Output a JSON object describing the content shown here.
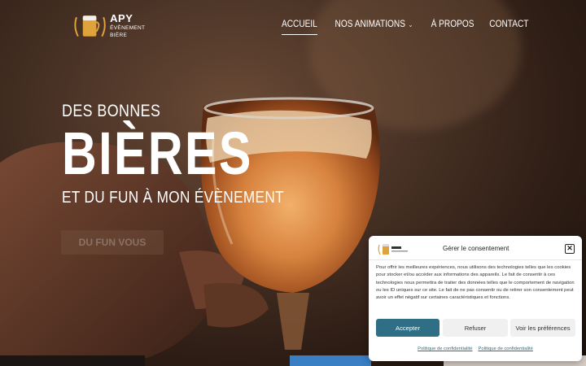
{
  "logo": {
    "title": "APY",
    "subtitle": "ÉVÈNEMENT BIÈRE"
  },
  "nav": [
    {
      "label": "ACCUEIL",
      "active": true
    },
    {
      "label": "NOS ANIMATIONS",
      "has_dropdown": true
    },
    {
      "label": "À PROPOS"
    },
    {
      "label": "CONTACT"
    }
  ],
  "hero": {
    "line1": "DES BONNES",
    "line2": "BIÈRES",
    "line3": "ET DU FUN À MON ÉVÈNEMENT",
    "cta": "DU FUN VOUS"
  },
  "consent": {
    "title": "Gérer le consentement",
    "body": "Pour offrir les meilleures expériences, nous utilisons des technologies telles que les cookies pour stocker et/ou accéder aux informations des appareils. Le fait de consentir à ces technologies nous permettra de traiter des données telles que le comportement de navigation ou les ID uniques sur ce site. Le fait de ne pas consentir ou de retirer son consentement peut avoir un effet négatif sur certaines caractéristiques et fonctions.",
    "accept": "Accepter",
    "refuse": "Refuser",
    "prefs": "Voir les préférences",
    "link1": "Politique de confidentialité",
    "link2": "Politique de confidentialité",
    "close": "✕"
  },
  "colors": {
    "accent": "#2f6f86",
    "beer": "#c9773a",
    "logo_gold": "#e0a23a"
  }
}
